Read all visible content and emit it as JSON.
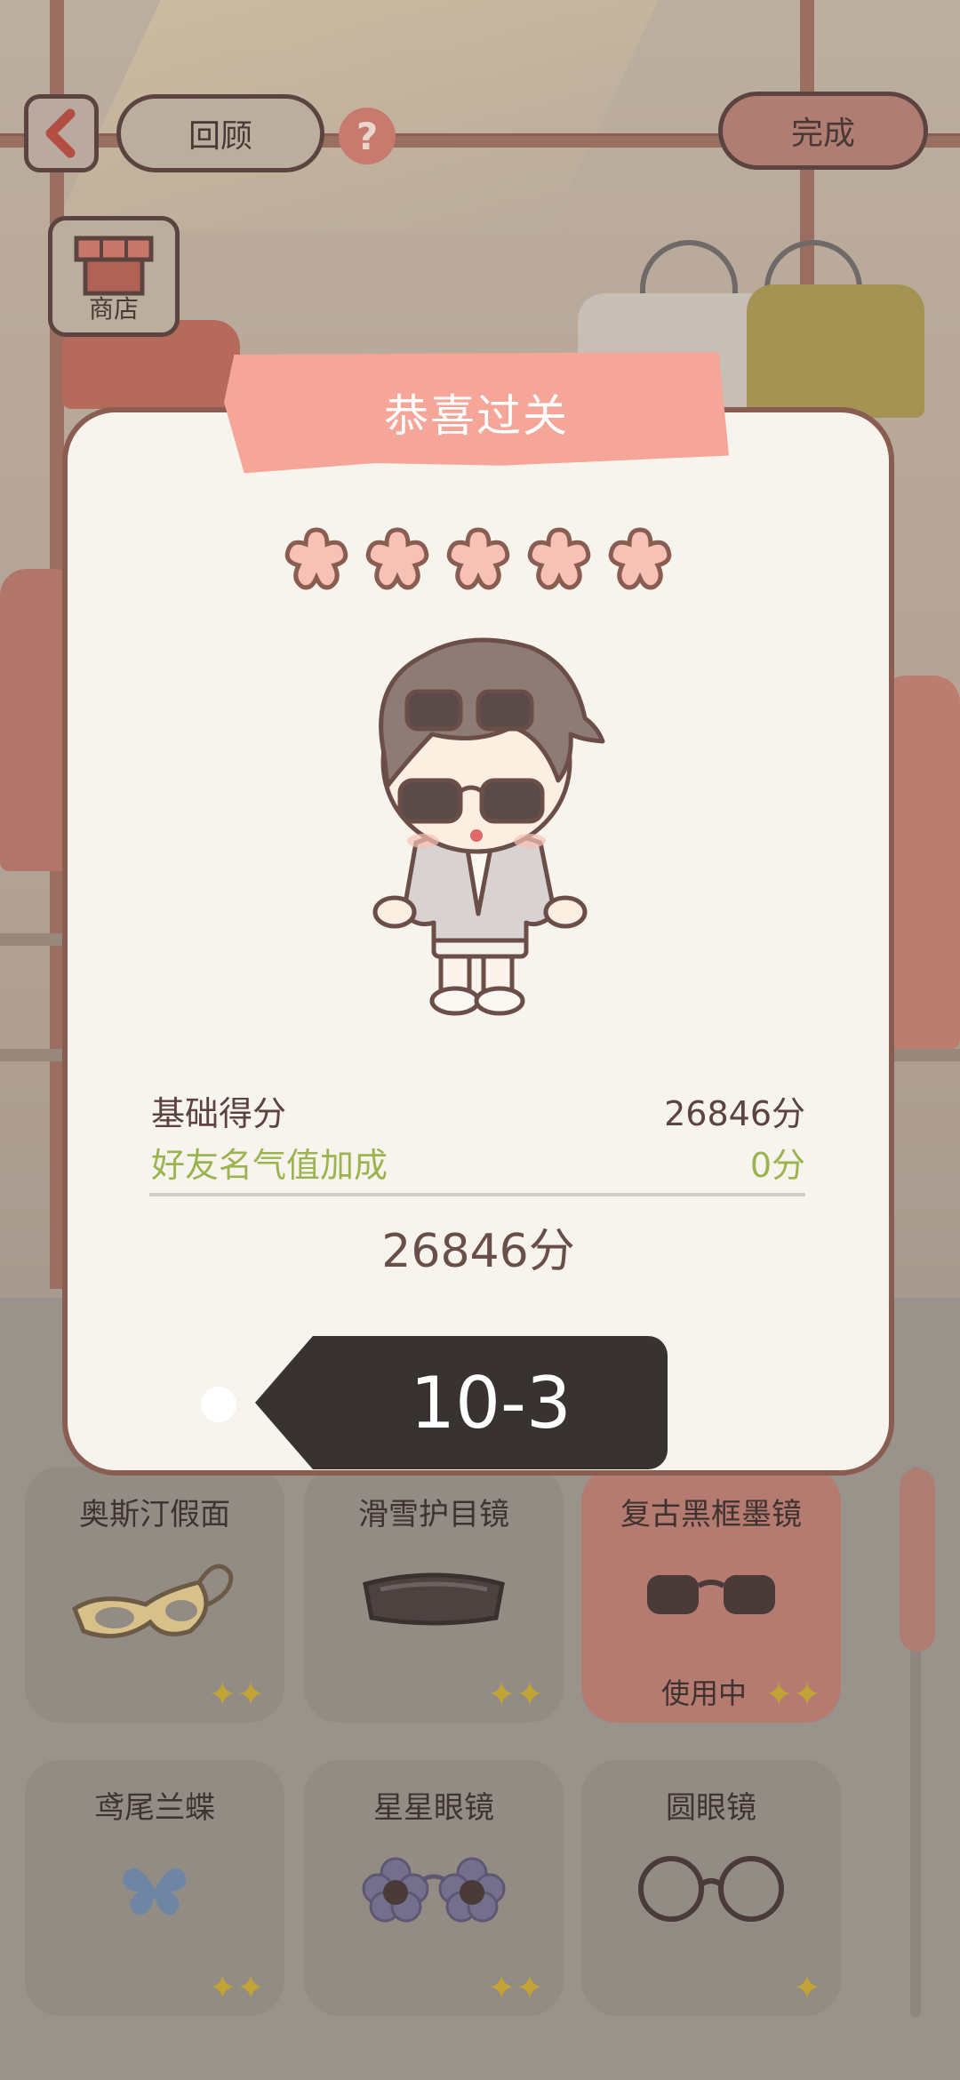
{
  "top_bar": {
    "back_icon": "chevron-left-icon",
    "review_label": "回顾",
    "help_icon": "question-mark-icon",
    "help_glyph": "?",
    "done_label": "完成",
    "shop_label": "商店"
  },
  "dialog": {
    "title": "恭喜过关",
    "stars": 5,
    "base_score_label": "基础得分",
    "base_score_value": "26846分",
    "bonus_label": "好友名气值加成",
    "bonus_value": "0分",
    "total": "26846分",
    "level": "10-3"
  },
  "items": [
    {
      "name": "奥斯汀假面",
      "icon": "mask-glasses-icon",
      "active": false,
      "status": ""
    },
    {
      "name": "滑雪护目镜",
      "icon": "ski-goggles-icon",
      "active": false,
      "status": ""
    },
    {
      "name": "复古黑框墨镜",
      "icon": "black-sunglasses-icon",
      "active": true,
      "status": "使用中"
    },
    {
      "name": "鸢尾兰蝶",
      "icon": "butterfly-icon",
      "active": false,
      "status": ""
    },
    {
      "name": "星星眼镜",
      "icon": "flower-glasses-icon",
      "active": false,
      "status": ""
    },
    {
      "name": "圆眼镜",
      "icon": "round-glasses-icon",
      "active": false,
      "status": ""
    }
  ],
  "colors": {
    "banner": "#f6a699",
    "dialog_bg": "#f7f4ee",
    "bonus_text": "#9cb450",
    "level_bg": "#383331",
    "star_fill": "#f7c1b5"
  }
}
